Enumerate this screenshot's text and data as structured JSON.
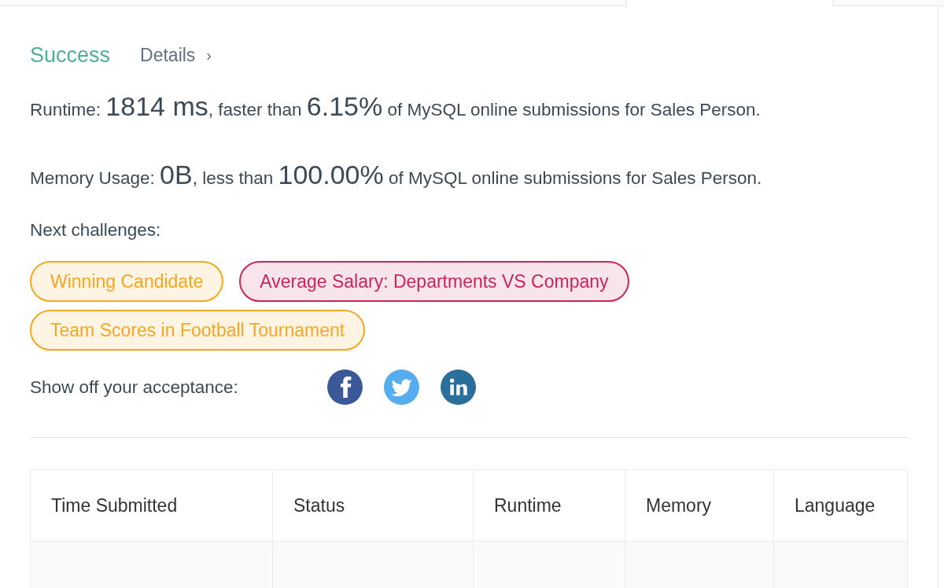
{
  "result": {
    "status": "Success",
    "details_link": "Details",
    "details_arrow": "›"
  },
  "stats": [
    {
      "label": "Runtime:",
      "value": "1814 ms",
      "middle": ", faster than",
      "percent": "6.15%",
      "tail": "of MySQL online submissions for Sales Person."
    },
    {
      "label": "Memory Usage:",
      "value": "0B",
      "middle": ", less than",
      "percent": "100.00%",
      "tail": "of MySQL online submissions for Sales Person."
    }
  ],
  "next_challenges": {
    "label": "Next challenges:",
    "items": [
      {
        "title": "Winning Candidate",
        "color": "#f5a623"
      },
      {
        "title": "Average Salary: Departments VS Company",
        "color": "#c7255e"
      },
      {
        "title": "Team Scores in Football Tournament",
        "color": "#f5a623"
      }
    ]
  },
  "share": {
    "label": "Show off your acceptance:"
  },
  "table": {
    "columns": [
      "Time Submitted",
      "Status",
      "Runtime",
      "Memory",
      "Language"
    ]
  }
}
